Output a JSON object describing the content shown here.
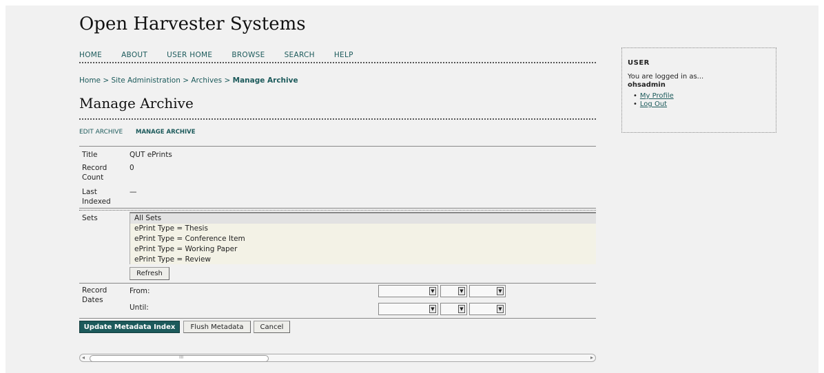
{
  "site": {
    "title": "Open Harvester Systems"
  },
  "nav": {
    "items": [
      "HOME",
      "ABOUT",
      "USER HOME",
      "BROWSE",
      "SEARCH",
      "HELP"
    ]
  },
  "breadcrumb": {
    "home": "Home",
    "sep": ">",
    "admin": "Site Administration",
    "archives": "Archives",
    "current": "Manage Archive"
  },
  "page": {
    "heading": "Manage Archive"
  },
  "subnav": {
    "edit": "EDIT ARCHIVE",
    "manage": "MANAGE ARCHIVE"
  },
  "details": {
    "title_label": "Title",
    "title_value": "QUT ePrints",
    "count_label_1": "Record",
    "count_label_2": "Count",
    "count_value": "0",
    "indexed_label_1": "Last",
    "indexed_label_2": "Indexed",
    "indexed_value": "—"
  },
  "sets": {
    "label": "Sets",
    "options": [
      "All Sets",
      "ePrint Type = Thesis",
      "ePrint Type = Conference Item",
      "ePrint Type = Working Paper",
      "ePrint Type = Review"
    ],
    "refresh_label": "Refresh"
  },
  "dates": {
    "label_1": "Record",
    "label_2": "Dates",
    "from": "From:",
    "until": "Until:"
  },
  "actions": {
    "update": "Update Metadata Index",
    "flush": "Flush Metadata",
    "cancel": "Cancel"
  },
  "sidebar": {
    "title": "USER",
    "logged_in": "You are logged in as...",
    "username": "ohsadmin",
    "links": [
      "My Profile",
      "Log Out"
    ]
  },
  "scrollbar": {
    "grip": "III"
  }
}
